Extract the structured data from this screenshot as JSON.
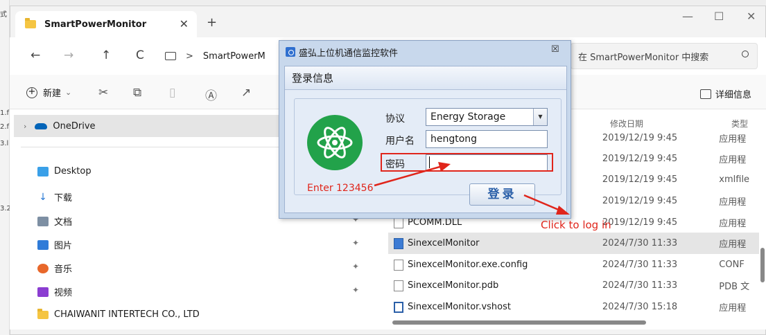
{
  "left_strip": {
    "chars": [
      "式",
      "1.f",
      "2.f",
      "3.l",
      "3.2"
    ]
  },
  "window": {
    "tab_title": "SmartPowerMonitor",
    "tab_close": "✕",
    "new_tab": "+",
    "minimize": "—",
    "maximize": "☐",
    "close": "✕"
  },
  "nav": {
    "back": "←",
    "forward": "→",
    "up": "↑",
    "refresh": "C",
    "separator": ">",
    "address": "SmartPowerM",
    "search_placeholder": "在 SmartPowerMonitor 中搜索",
    "search_icon": "search-icon"
  },
  "toolbar": {
    "new_label": "新建",
    "new_caret": "⌄",
    "details_label": "详细信息"
  },
  "sidebar": {
    "onedrive": "OneDrive",
    "items": [
      {
        "label": "Desktop",
        "icon": "desktop-icon",
        "color": "#3aa0e8"
      },
      {
        "label": "下载",
        "icon": "download-icon",
        "color": "#2a7ad5"
      },
      {
        "label": "文档",
        "icon": "document-icon",
        "color": "#7d8fa3"
      },
      {
        "label": "图片",
        "icon": "pictures-icon",
        "color": "#2f7bd8"
      },
      {
        "label": "音乐",
        "icon": "music-icon",
        "color": "#e8672a"
      },
      {
        "label": "视频",
        "icon": "video-icon",
        "color": "#8b3dd1"
      },
      {
        "label": "CHAIWANIT INTERTECH CO., LTD",
        "icon": "folder-icon",
        "color": "#f5c542"
      }
    ],
    "pin": "📌"
  },
  "files": {
    "columns": {
      "date": "修改日期",
      "type": "类型"
    },
    "rows": [
      {
        "name": "",
        "date": "2019/12/19 9:45",
        "type": "应用程"
      },
      {
        "name": "",
        "date": "2019/12/19 9:45",
        "type": "应用程"
      },
      {
        "name": "",
        "date": "2019/12/19 9:45",
        "type": "xmlfile"
      },
      {
        "name": "",
        "date": "2019/12/19 9:45",
        "type": "应用程"
      },
      {
        "name": "PCOMM.DLL",
        "date": "2019/12/19 9:45",
        "type": "应用程"
      },
      {
        "name": "SinexcelMonitor",
        "date": "2024/7/30 11:33",
        "type": "应用程"
      },
      {
        "name": "SinexcelMonitor.exe.config",
        "date": "2024/7/30 11:33",
        "type": "CONF"
      },
      {
        "name": "SinexcelMonitor.pdb",
        "date": "2024/7/30 11:33",
        "type": "PDB 文"
      },
      {
        "name": "SinexcelMonitor.vshost",
        "date": "2024/7/30 15:18",
        "type": "应用程"
      }
    ]
  },
  "dialog": {
    "title": "盛弘上位机通信监控软件",
    "close": "☒",
    "section": "登录信息",
    "protocol_label": "协议",
    "protocol_value": "Energy Storage",
    "protocol_caret": "▼",
    "user_label": "用户名",
    "user_value": "hengtong",
    "password_label": "密码",
    "password_value": "",
    "login_button": "登录"
  },
  "annotations": {
    "enter_hint": "Enter 123456",
    "click_hint": "Click to log in",
    "color": "#e0251b"
  }
}
